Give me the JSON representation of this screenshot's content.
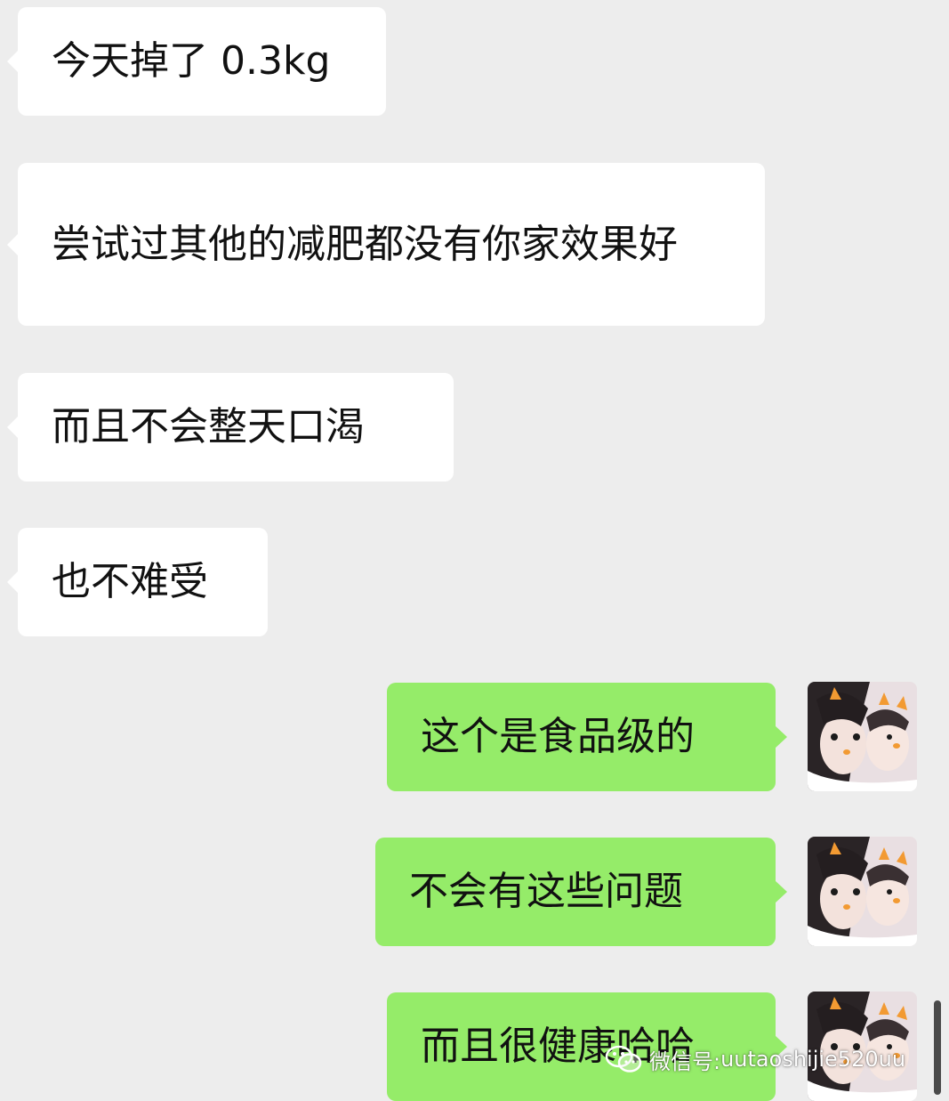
{
  "messages": [
    {
      "text": "今天掉了 0.3kg"
    },
    {
      "text": "尝试过其他的减肥都没有你家效果好"
    },
    {
      "text": "而且不会整天口渴"
    },
    {
      "text": "也不难受"
    },
    {
      "text": "这个是食品级的"
    },
    {
      "text": "不会有这些问题"
    },
    {
      "text": "而且很健康哈哈"
    }
  ],
  "watermark": {
    "label": "微信号:",
    "account": "uutaoshijie520uu",
    "icon": "wechat-icon"
  },
  "colors": {
    "background": "#ededed",
    "incoming_bubble": "#ffffff",
    "outgoing_bubble": "#95ec69",
    "text": "#111111"
  }
}
